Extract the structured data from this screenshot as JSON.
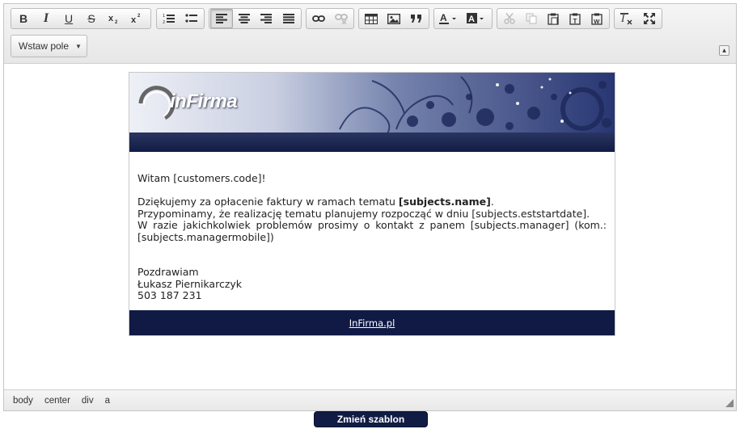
{
  "toolbar": {
    "field_dropdown": "Wstaw pole",
    "buttons": {
      "bold": "B",
      "italic": "I",
      "underline": "U",
      "strike": "S"
    }
  },
  "email": {
    "logo_text": "inFirma",
    "greeting": "Witam [customers.code]!",
    "line1_pre": "Dziękujemy za opłacenie faktury w ramach tematu ",
    "line1_bold": "[subjects.name]",
    "line1_post": ".",
    "line2": "Przypominamy, że realizację tematu planujemy rozpocząć w dniu [subjects.eststartdate].",
    "line3": "W razie jakichkolwiek problemów prosimy o kontakt z panem [subjects.manager] (kom.: [subjects.managermobile])",
    "closing": "Pozdrawiam",
    "signature_name": "Łukasz Piernikarczyk",
    "signature_phone": "503 187 231",
    "footer_link": "InFirma.pl"
  },
  "statusbar": {
    "path": [
      "body",
      "center",
      "div",
      "a"
    ]
  },
  "change_template_button": "Zmień szablon",
  "colors": {
    "navy": "#111c45",
    "toolbar_bg": "#ececec"
  }
}
